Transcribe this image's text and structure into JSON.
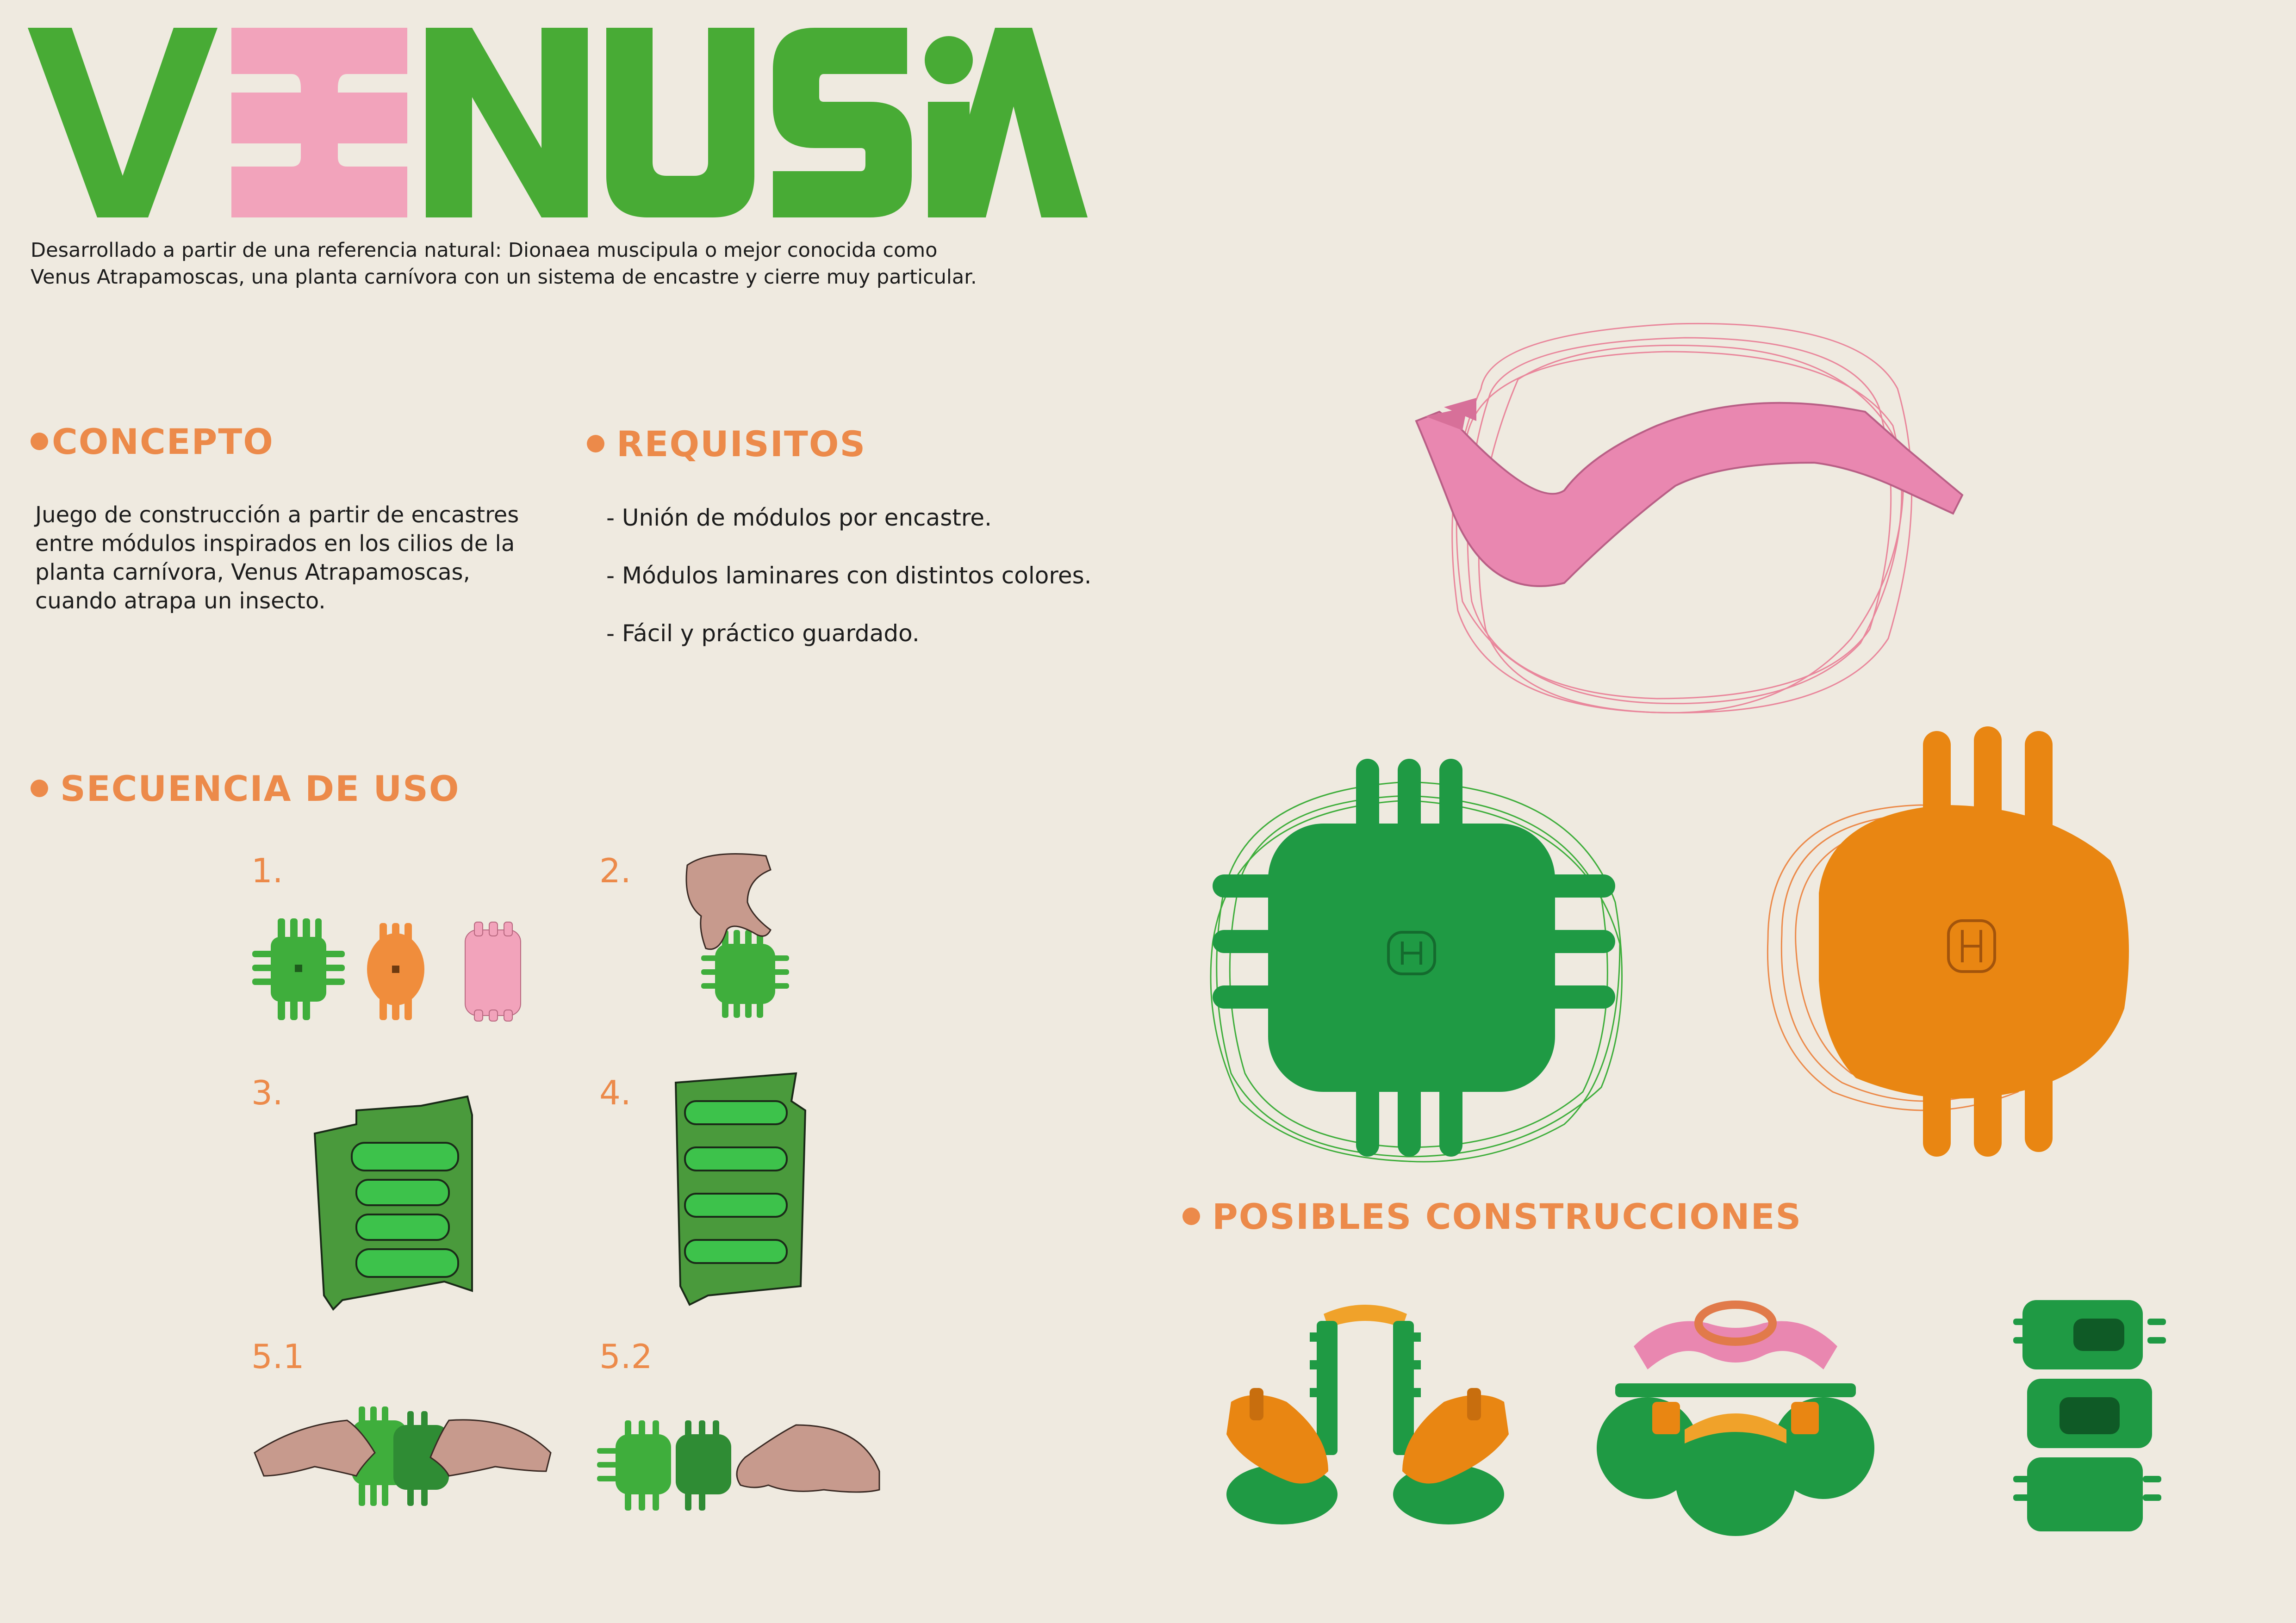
{
  "title": {
    "letters": [
      "V",
      "E",
      "N",
      "U",
      "S",
      "i",
      "A"
    ],
    "colors": {
      "green": "#48ab35",
      "pink": "#f2a3bb"
    }
  },
  "intro": {
    "line1": "Desarrollado a partir de una referencia natural: Dionaea muscipula o mejor conocida como",
    "line2": "Venus Atrapamoscas, una planta carnívora con un sistema de encastre y cierre muy particular."
  },
  "concepto": {
    "heading": "CONCEPTO",
    "lines": [
      "Juego de construcción a partir de encastres",
      "entre módulos inspirados en los cilios de la",
      "planta carnívora, Venus Atrapamoscas,",
      "cuando atrapa un insecto."
    ]
  },
  "requisitos": {
    "heading": "REQUISITOS",
    "items": [
      "- Unión de módulos por encastre.",
      "- Módulos laminares con distintos colores.",
      "- Fácil y práctico guardado."
    ]
  },
  "secuencia": {
    "heading": "SECUENCIA DE USO",
    "steps": [
      "1.",
      "2.",
      "3.",
      "4.",
      "5.1",
      "5.2"
    ]
  },
  "construcciones": {
    "heading": "POSIBLES CONSTRUCCIONES"
  },
  "colors": {
    "background": "#efeae0",
    "accent_orange": "#ec8a4a",
    "module_green": "#1f9a44",
    "module_orange": "#e98612",
    "module_pink": "#e987b0"
  }
}
